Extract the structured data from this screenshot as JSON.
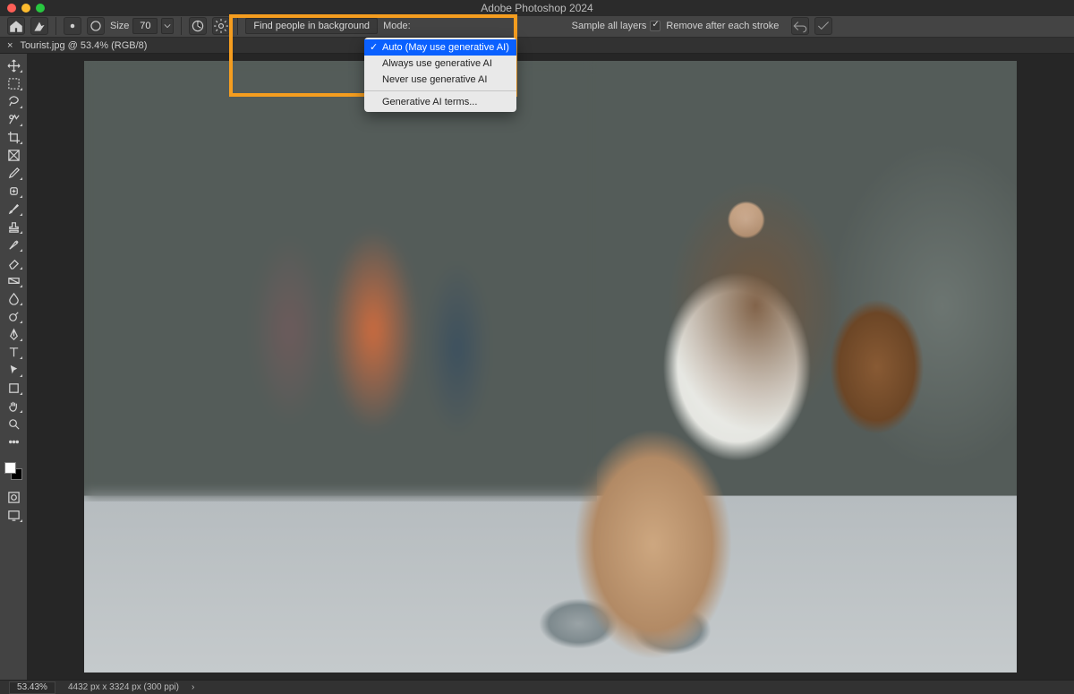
{
  "app_title": "Adobe Photoshop 2024",
  "options": {
    "size_label": "Size",
    "size_value": "70",
    "find_label": "Find people in background",
    "mode_label": "Mode:",
    "sample_label": "Sample all layers",
    "remove_label": "Remove after each stroke"
  },
  "dropdown": {
    "item_auto": "Auto (May use generative AI)",
    "item_always": "Always use generative AI",
    "item_never": "Never use generative AI",
    "item_terms": "Generative AI terms..."
  },
  "doc_tab": "Tourist.jpg @ 53.4% (RGB/8)",
  "status": {
    "zoom": "53.43%",
    "info": "4432 px x 3324 px (300 ppi)"
  }
}
